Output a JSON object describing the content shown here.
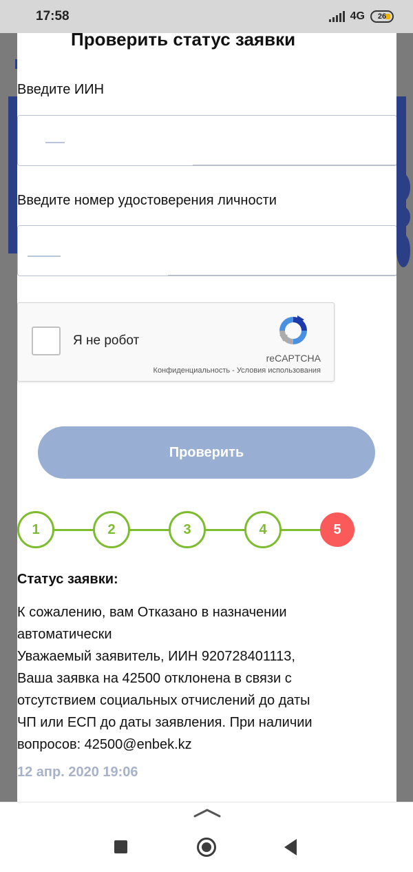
{
  "status_bar": {
    "time": "17:58",
    "network": "4G",
    "battery": "26"
  },
  "modal": {
    "title": "Проверить статус заявки",
    "iin_label": "Введите ИИН",
    "iin_value": "",
    "id_label": "Введите номер удостоверения личности",
    "id_value": ""
  },
  "recaptcha": {
    "label": "Я не робот",
    "brand": "reCAPTCHA",
    "privacy": "Конфиденциальность",
    "separator": " - ",
    "terms": "Условия использования"
  },
  "check_button": {
    "label": "Проверить"
  },
  "steps": {
    "items": [
      "1",
      "2",
      "3",
      "4",
      "5"
    ],
    "current": 5
  },
  "status": {
    "title": "Статус заявки:",
    "lines": [
      "К сожалению, вам Отказано в назначении",
      "автоматически",
      "Уважаемый заявитель, ИИН 920728401113,",
      "Ваша заявка на 42500 отклонена в связи с",
      "отсутствием социальных отчислений до даты",
      "ЧП или ЕСП до даты заявления. При наличии",
      "вопросов: 42500@enbek.kz"
    ],
    "date": "12 апр. 2020 19:06"
  },
  "colors": {
    "step_done": "#7dbb2f",
    "step_current": "#fb5a5a",
    "button": "#98aed3",
    "date": "#a7b2c9"
  }
}
